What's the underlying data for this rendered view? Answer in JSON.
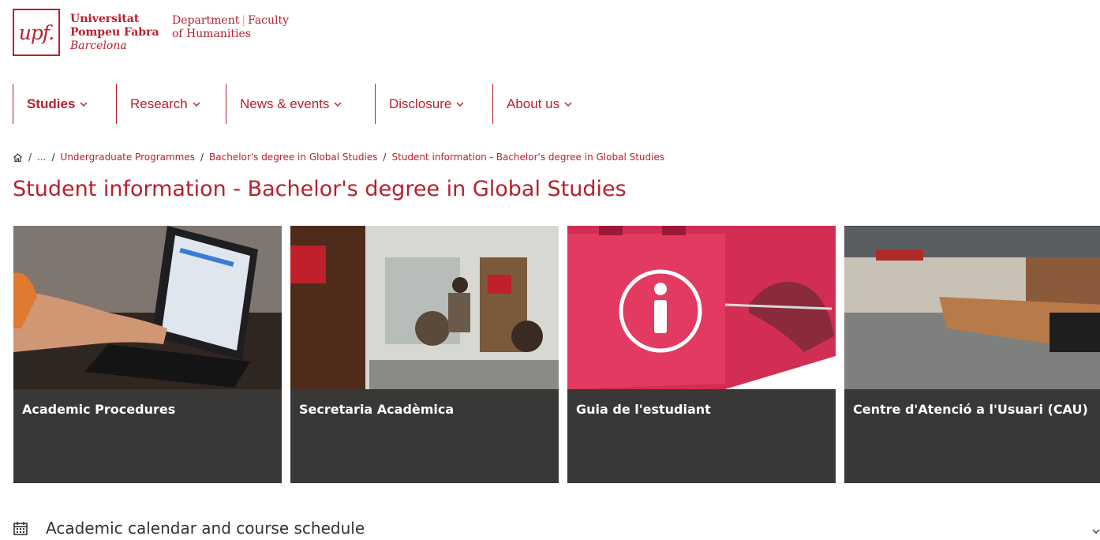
{
  "logo": {
    "mark": "upf.",
    "line1": "Universitat",
    "line2": "Pompeu Fabra",
    "line3": "Barcelona",
    "dept_a": "Department",
    "dept_sep": "|",
    "dept_b": "Faculty",
    "dept_line2": "of Humanities"
  },
  "nav": {
    "items": [
      {
        "label": "Studies",
        "active": true
      },
      {
        "label": "Research"
      },
      {
        "label": "News & events"
      },
      {
        "label": "Disclosure"
      },
      {
        "label": "About us"
      }
    ]
  },
  "breadcrumb": {
    "ellipsis": "...",
    "sep": "/",
    "items": [
      "Undergraduate Programmes",
      "Bachelor's degree in Global Studies",
      "Student information - Bachelor's degree in Global Studies"
    ]
  },
  "page_title": "Student information - Bachelor's degree in Global Studies",
  "cards": [
    {
      "label": "Academic Procedures"
    },
    {
      "label": "Secretaria Acadèmica"
    },
    {
      "label": "Guia de l'estudiant"
    },
    {
      "label": "Centre d'Atenció a l'Usuari (CAU)"
    }
  ],
  "accordion": {
    "label": "Academic calendar and course schedule"
  },
  "colors": {
    "brand": "#b6202e",
    "card_label_bg": "#3a3836"
  }
}
